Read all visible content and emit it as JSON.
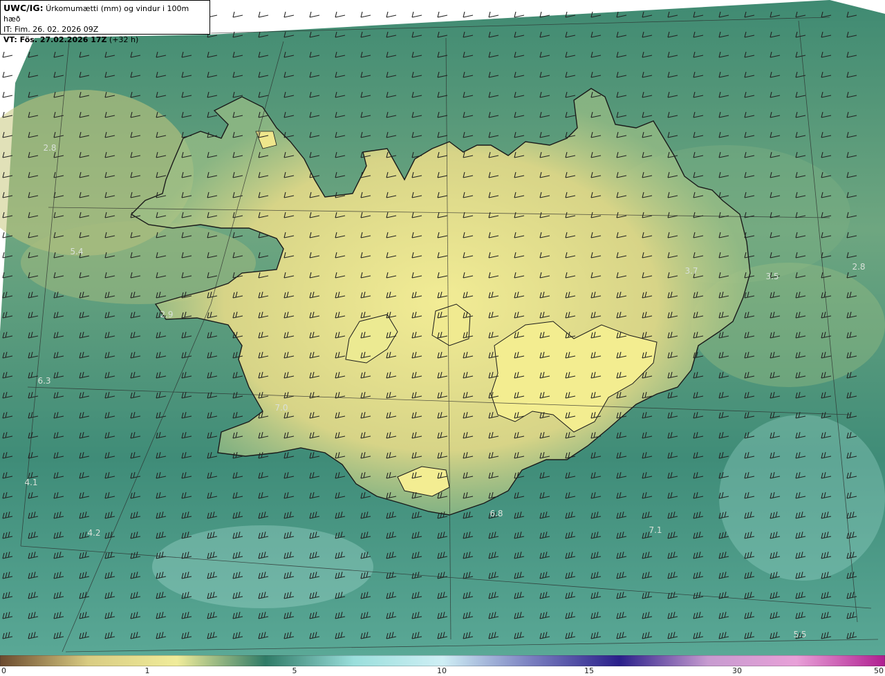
{
  "header": {
    "model": "UWC/IG:",
    "title_text": "Úrkomumætti (mm) og vindur i 100m hæð",
    "issue_line": "IT: Fim. 26. 02. 2026 09Z",
    "valid_prefix": "VT: Fös. 27.02.2026 17Z",
    "lead": "(+32 h)"
  },
  "field_values": [
    "2.8",
    "5.4",
    "2.9",
    "6.3",
    "7.0",
    "4.1",
    "4.2",
    "3.7",
    "3.5",
    "2.8",
    "6.8",
    "7.1",
    "5.5"
  ],
  "colorbar": {
    "ticks": [
      "0",
      "1",
      "5",
      "10",
      "15",
      "30",
      "50"
    ],
    "colors": [
      "#6b4a2e",
      "#d9cc82",
      "#f0ec9a",
      "#2f7a66",
      "#9adfdc",
      "#cfeff5",
      "#7a7fc0",
      "#2a1f8a",
      "#c79bd0",
      "#e8a0d8",
      "#b01e90"
    ]
  },
  "map": {
    "land_color": "#e9e08a",
    "sea_color": "#3e8c74",
    "coast_color": "#1a1a1a",
    "grid_color": "#2a2a2a",
    "barb_color": "#222222"
  }
}
